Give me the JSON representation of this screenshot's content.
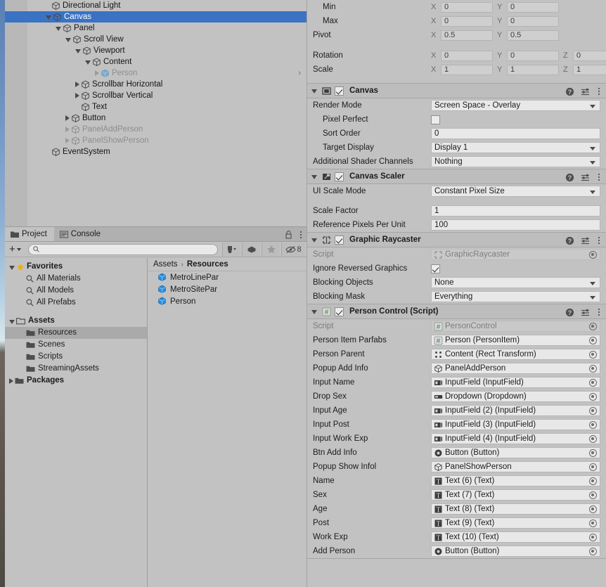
{
  "hierarchy": {
    "items": [
      {
        "label": "Directional Light",
        "depth": 1,
        "toggle": "none",
        "icon": "cube-outline-icon",
        "selected": false,
        "dim": false
      },
      {
        "label": "Canvas",
        "depth": 1,
        "toggle": "open",
        "icon": "cube-outline-icon",
        "selected": true,
        "dim": false
      },
      {
        "label": "Panel",
        "depth": 2,
        "toggle": "open",
        "icon": "cube-outline-icon",
        "selected": false,
        "dim": false
      },
      {
        "label": "Scroll View",
        "depth": 3,
        "toggle": "open",
        "icon": "cube-outline-icon",
        "selected": false,
        "dim": false
      },
      {
        "label": "Viewport",
        "depth": 4,
        "toggle": "open",
        "icon": "cube-outline-icon",
        "selected": false,
        "dim": false
      },
      {
        "label": "Content",
        "depth": 5,
        "toggle": "open",
        "icon": "cube-outline-icon",
        "selected": false,
        "dim": false
      },
      {
        "label": "Person",
        "depth": 6,
        "toggle": "closed",
        "icon": "prefab-cube-icon",
        "selected": false,
        "dim": true,
        "chevron": "›"
      },
      {
        "label": "Scrollbar Horizontal",
        "depth": 4,
        "toggle": "closed",
        "icon": "cube-outline-icon",
        "selected": false,
        "dim": false
      },
      {
        "label": "Scrollbar Vertical",
        "depth": 4,
        "toggle": "closed",
        "icon": "cube-outline-icon",
        "selected": false,
        "dim": false
      },
      {
        "label": "Text",
        "depth": 4,
        "toggle": "none",
        "icon": "cube-outline-icon",
        "selected": false,
        "dim": false
      },
      {
        "label": "Button",
        "depth": 3,
        "toggle": "closed",
        "icon": "cube-outline-icon",
        "selected": false,
        "dim": false
      },
      {
        "label": "PanelAddPerson",
        "depth": 3,
        "toggle": "closed",
        "icon": "cube-outline-icon",
        "selected": false,
        "dim": true
      },
      {
        "label": "PanelShowPerson",
        "depth": 3,
        "toggle": "closed",
        "icon": "cube-outline-icon",
        "selected": false,
        "dim": true
      },
      {
        "label": "EventSystem",
        "depth": 1,
        "toggle": "none",
        "icon": "cube-outline-icon",
        "selected": false,
        "dim": false
      }
    ]
  },
  "project": {
    "tabs": [
      {
        "label": "Project",
        "icon": "folder-icon",
        "active": true
      },
      {
        "label": "Console",
        "icon": "console-icon",
        "active": false
      }
    ],
    "toolbar": {
      "add_label": "+",
      "search_value": "",
      "search_placeholder": "",
      "hidden_count": "8",
      "buttons": [
        "type-filter-icon",
        "label-filter-icon",
        "favorite-star-icon",
        "hidden-items-icon"
      ]
    },
    "tree": [
      {
        "label": "Favorites",
        "icon": "star-icon",
        "toggle": "open",
        "depth": 0,
        "bold": true,
        "selected": false
      },
      {
        "label": "All Materials",
        "icon": "search-icon",
        "toggle": "none",
        "depth": 1,
        "bold": false,
        "selected": false
      },
      {
        "label": "All Models",
        "icon": "search-icon",
        "toggle": "none",
        "depth": 1,
        "bold": false,
        "selected": false
      },
      {
        "label": "All Prefabs",
        "icon": "search-icon",
        "toggle": "none",
        "depth": 1,
        "bold": false,
        "selected": false
      },
      {
        "label": "Assets",
        "icon": "folder-open-icon",
        "toggle": "open",
        "depth": 0,
        "bold": true,
        "selected": false
      },
      {
        "label": "Resources",
        "icon": "folder-icon",
        "toggle": "none",
        "depth": 1,
        "bold": false,
        "selected": true
      },
      {
        "label": "Scenes",
        "icon": "folder-icon",
        "toggle": "none",
        "depth": 1,
        "bold": false,
        "selected": false
      },
      {
        "label": "Scripts",
        "icon": "folder-icon",
        "toggle": "none",
        "depth": 1,
        "bold": false,
        "selected": false
      },
      {
        "label": "StreamingAssets",
        "icon": "folder-icon",
        "toggle": "none",
        "depth": 1,
        "bold": false,
        "selected": false
      },
      {
        "label": "Packages",
        "icon": "folder-icon",
        "toggle": "closed",
        "depth": 0,
        "bold": true,
        "selected": false
      }
    ],
    "breadcrumb": {
      "root": "Assets",
      "sep": "›",
      "current": "Resources"
    },
    "assets": [
      {
        "label": "MetroLinePar",
        "icon": "prefab-cube-icon"
      },
      {
        "label": "MetroSitePar",
        "icon": "prefab-cube-icon"
      },
      {
        "label": "Person",
        "icon": "prefab-cube-icon"
      }
    ]
  },
  "inspector": {
    "rect_transform_tail": [
      {
        "label": "Min",
        "indent": true,
        "axes": [
          {
            "axis": "X",
            "value": "0"
          },
          {
            "axis": "Y",
            "value": "0"
          }
        ]
      },
      {
        "label": "Max",
        "indent": true,
        "axes": [
          {
            "axis": "X",
            "value": "0"
          },
          {
            "axis": "Y",
            "value": "0"
          }
        ]
      },
      {
        "label": "Pivot",
        "indent": false,
        "axes": [
          {
            "axis": "X",
            "value": "0.5"
          },
          {
            "axis": "Y",
            "value": "0.5"
          }
        ]
      }
    ],
    "transform_tail": [
      {
        "label": "Rotation",
        "axes": [
          {
            "axis": "X",
            "value": "0"
          },
          {
            "axis": "Y",
            "value": "0"
          },
          {
            "axis": "Z",
            "value": "0"
          }
        ]
      },
      {
        "label": "Scale",
        "axes": [
          {
            "axis": "X",
            "value": "1"
          },
          {
            "axis": "Y",
            "value": "1"
          },
          {
            "axis": "Z",
            "value": "1"
          }
        ]
      }
    ],
    "components": [
      {
        "name": "Canvas",
        "icon": "canvas-icon",
        "enabled": true,
        "expanded": true,
        "rows": [
          {
            "label": "Render Mode",
            "indent": false,
            "kind": "dropdown",
            "value": "Screen Space - Overlay"
          },
          {
            "label": "Pixel Perfect",
            "indent": true,
            "kind": "checkbox",
            "checked": false
          },
          {
            "label": "Sort Order",
            "indent": true,
            "kind": "text",
            "value": "0"
          },
          {
            "label": "Target Display",
            "indent": true,
            "kind": "dropdown",
            "value": "Display 1"
          },
          {
            "label": "Additional Shader Channels",
            "indent": false,
            "kind": "dropdown",
            "value": "Nothing"
          }
        ]
      },
      {
        "name": "Canvas Scaler",
        "icon": "canvas-scaler-icon",
        "enabled": true,
        "expanded": true,
        "rows": [
          {
            "label": "UI Scale Mode",
            "indent": false,
            "kind": "dropdown",
            "value": "Constant Pixel Size"
          },
          {
            "label": "",
            "indent": false,
            "kind": "spacer"
          },
          {
            "label": "Scale Factor",
            "indent": false,
            "kind": "text",
            "value": "1"
          },
          {
            "label": "Reference Pixels Per Unit",
            "indent": false,
            "kind": "text",
            "value": "100"
          }
        ]
      },
      {
        "name": "Graphic Raycaster",
        "icon": "graphic-raycaster-icon",
        "enabled": true,
        "expanded": true,
        "rows": [
          {
            "label": "Script",
            "indent": false,
            "kind": "objref-disabled",
            "value": "GraphicRaycaster",
            "value_icon": "raycaster-icon"
          },
          {
            "label": "Ignore Reversed Graphics",
            "indent": false,
            "kind": "checkbox",
            "checked": true
          },
          {
            "label": "Blocking Objects",
            "indent": false,
            "kind": "dropdown",
            "value": "None"
          },
          {
            "label": "Blocking Mask",
            "indent": false,
            "kind": "dropdown",
            "value": "Everything"
          }
        ]
      },
      {
        "name": "Person Control (Script)",
        "icon": "script-icon",
        "enabled": true,
        "expanded": true,
        "rows": [
          {
            "label": "Script",
            "indent": false,
            "kind": "objref-disabled",
            "value": "PersonControl",
            "value_icon": "script-icon"
          },
          {
            "label": "Person Item Parfabs",
            "indent": false,
            "kind": "objref",
            "value": "Person (PersonItem)",
            "value_icon": "script-icon"
          },
          {
            "label": "Person Parent",
            "indent": false,
            "kind": "objref",
            "value": "Content (Rect Transform)",
            "value_icon": "rect-transform-icon"
          },
          {
            "label": "Popup Add Info",
            "indent": false,
            "kind": "objref",
            "value": "PanelAddPerson",
            "value_icon": "gameobject-icon"
          },
          {
            "label": "Input Name",
            "indent": false,
            "kind": "objref",
            "value": "InputField (InputField)",
            "value_icon": "inputfield-icon"
          },
          {
            "label": "Drop Sex",
            "indent": false,
            "kind": "objref",
            "value": "Dropdown (Dropdown)",
            "value_icon": "dropdown-icon"
          },
          {
            "label": "Input Age",
            "indent": false,
            "kind": "objref",
            "value": "InputField (2) (InputField)",
            "value_icon": "inputfield-icon"
          },
          {
            "label": "Input Post",
            "indent": false,
            "kind": "objref",
            "value": "InputField (3) (InputField)",
            "value_icon": "inputfield-icon"
          },
          {
            "label": "Input Work Exp",
            "indent": false,
            "kind": "objref",
            "value": "InputField (4) (InputField)",
            "value_icon": "inputfield-icon"
          },
          {
            "label": "Btn Add Info",
            "indent": false,
            "kind": "objref",
            "value": "Button (Button)",
            "value_icon": "button-icon"
          },
          {
            "label": "Popup Show Infol",
            "indent": false,
            "kind": "objref",
            "value": "PanelShowPerson",
            "value_icon": "gameobject-icon"
          },
          {
            "label": "Name",
            "indent": false,
            "kind": "objref",
            "value": "Text (6) (Text)",
            "value_icon": "text-icon"
          },
          {
            "label": "Sex",
            "indent": false,
            "kind": "objref",
            "value": "Text (7) (Text)",
            "value_icon": "text-icon"
          },
          {
            "label": "Age",
            "indent": false,
            "kind": "objref",
            "value": "Text (8) (Text)",
            "value_icon": "text-icon"
          },
          {
            "label": "Post",
            "indent": false,
            "kind": "objref",
            "value": "Text (9) (Text)",
            "value_icon": "text-icon"
          },
          {
            "label": "Work Exp",
            "indent": false,
            "kind": "objref",
            "value": "Text (10) (Text)",
            "value_icon": "text-icon"
          },
          {
            "label": "Add Person",
            "indent": false,
            "kind": "objref",
            "value": "Button (Button)",
            "value_icon": "button-icon"
          }
        ]
      }
    ]
  },
  "colors": {
    "selection_blue": "#3a72c4",
    "panel_bg": "#c2c2c2",
    "header_bg": "#bdbdbd",
    "field_bg": "#e8e8e8",
    "prefab_blue": "#1f8ae0"
  }
}
